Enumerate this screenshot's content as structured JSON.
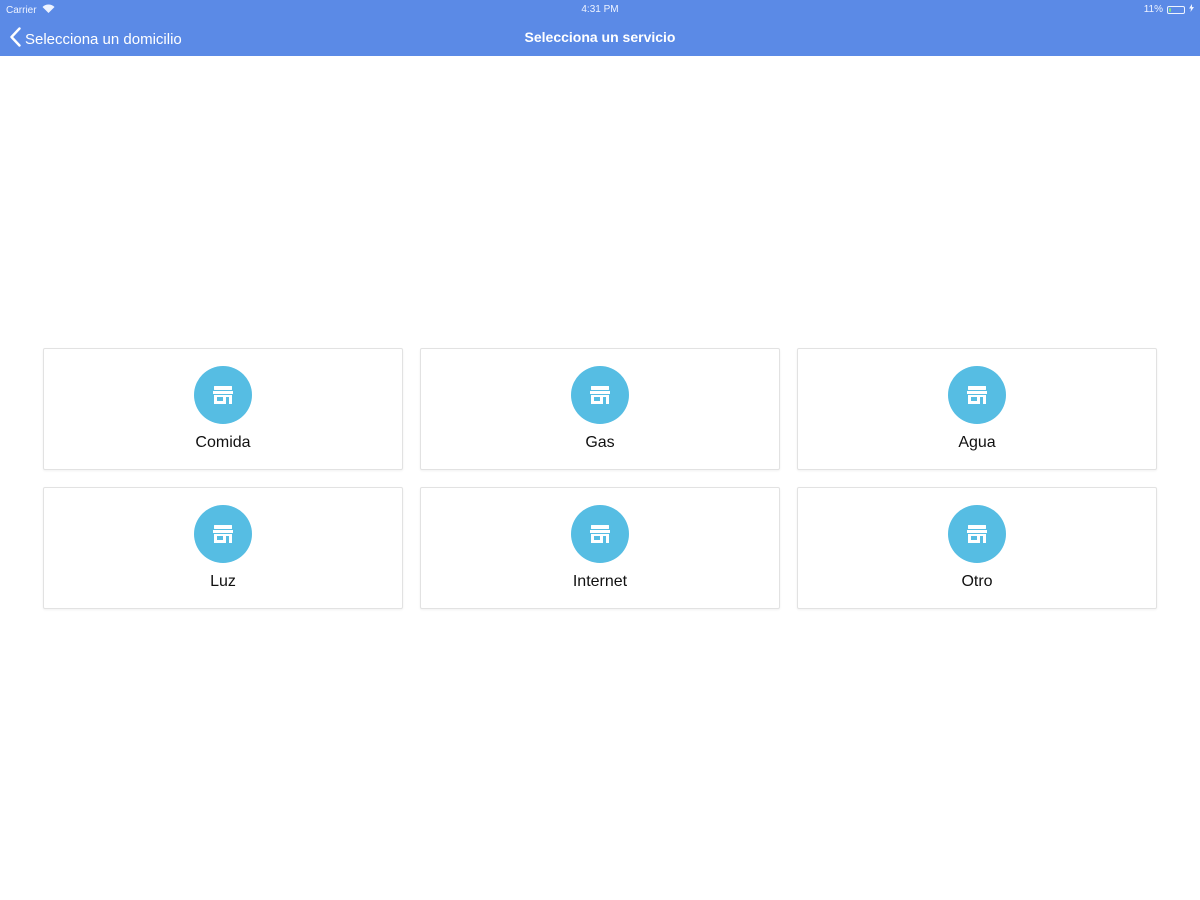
{
  "status_bar": {
    "carrier": "Carrier",
    "time": "4:31 PM",
    "battery_text": "11%",
    "battery_level": 0.11,
    "icons": [
      "wifi-icon",
      "battery-icon",
      "charging-icon"
    ]
  },
  "nav": {
    "back_label": "Selecciona un domicilio",
    "title": "Selecciona un servicio",
    "background_color": "#5b8ae6"
  },
  "services": [
    {
      "label": "Comida",
      "icon": "store-icon"
    },
    {
      "label": "Gas",
      "icon": "store-icon"
    },
    {
      "label": "Agua",
      "icon": "store-icon"
    },
    {
      "label": "Luz",
      "icon": "store-icon"
    },
    {
      "label": "Internet",
      "icon": "store-icon"
    },
    {
      "label": "Otro",
      "icon": "store-icon"
    }
  ],
  "colors": {
    "accent": "#5b8ae6",
    "icon_circle": "#56bde3"
  }
}
